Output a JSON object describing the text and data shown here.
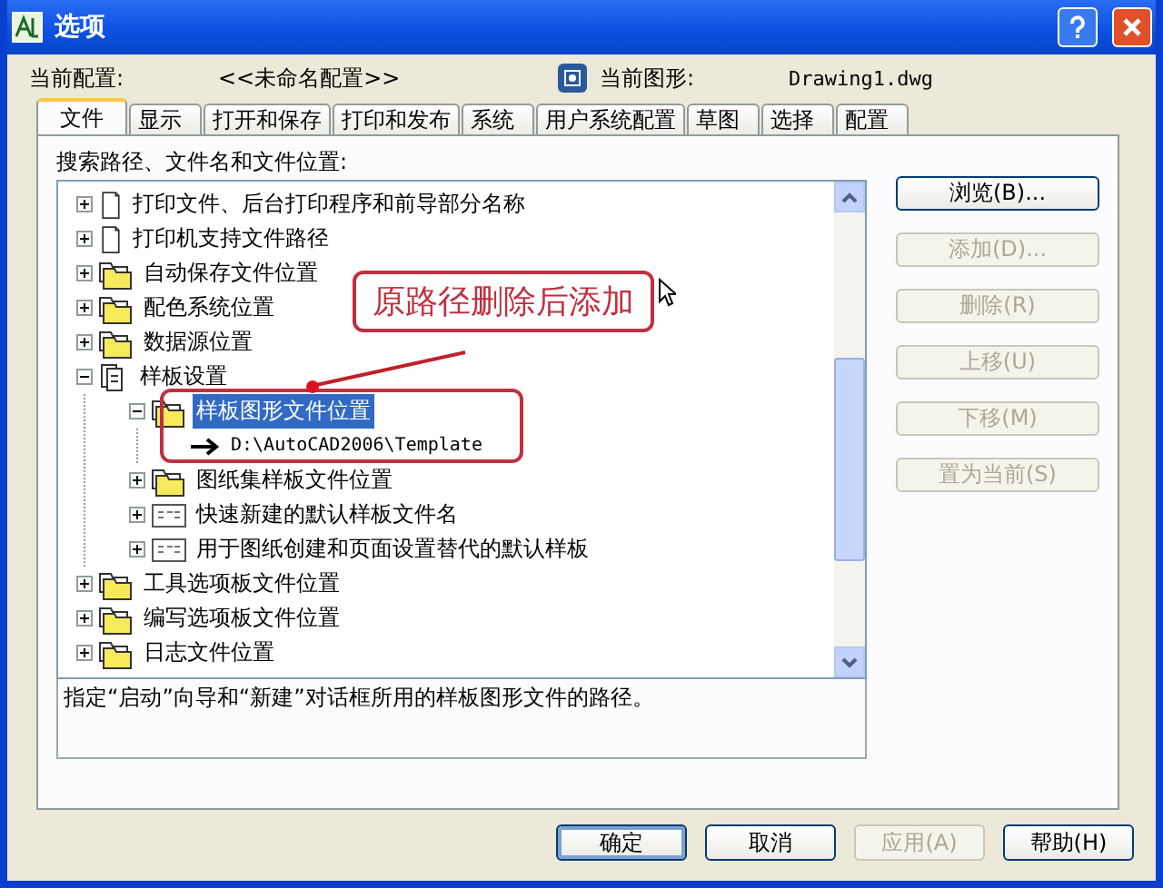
{
  "window": {
    "title": "选项"
  },
  "profile": {
    "label": "当前配置:",
    "value": "<<未命名配置>>"
  },
  "drawing": {
    "label": "当前图形:",
    "value": "Drawing1.dwg"
  },
  "tabs": [
    {
      "label": "文件",
      "selected": true
    },
    {
      "label": "显示",
      "selected": false
    },
    {
      "label": "打开和保存",
      "selected": false
    },
    {
      "label": "打印和发布",
      "selected": false
    },
    {
      "label": "系统",
      "selected": false
    },
    {
      "label": "用户系统配置",
      "selected": false
    },
    {
      "label": "草图",
      "selected": false
    },
    {
      "label": "选择",
      "selected": false
    },
    {
      "label": "配置",
      "selected": false
    }
  ],
  "tree": {
    "label": "搜索路径、文件名和文件位置:",
    "items": [
      {
        "label": "打印文件、后台打印程序和前导部分名称",
        "kind": "doc",
        "expanded": false,
        "selected": false
      },
      {
        "label": "打印机支持文件路径",
        "kind": "doc",
        "expanded": false,
        "selected": false
      },
      {
        "label": "自动保存文件位置",
        "kind": "folder",
        "expanded": false,
        "selected": false
      },
      {
        "label": "配色系统位置",
        "kind": "folder",
        "expanded": false,
        "selected": false
      },
      {
        "label": "数据源位置",
        "kind": "folder",
        "expanded": false,
        "selected": false
      },
      {
        "label": "样板设置",
        "kind": "pages",
        "expanded": true,
        "selected": false,
        "children": [
          {
            "label": "样板图形文件位置",
            "kind": "folder",
            "expanded": true,
            "selected": true,
            "children": [
              {
                "label": "D:\\AutoCAD2006\\Template",
                "kind": "path",
                "selected": false
              }
            ]
          },
          {
            "label": "图纸集样板文件位置",
            "kind": "folder",
            "expanded": false,
            "selected": false
          },
          {
            "label": "快速新建的默认样板文件名",
            "kind": "template",
            "expanded": false,
            "selected": false
          },
          {
            "label": "用于图纸创建和页面设置替代的默认样板",
            "kind": "template",
            "expanded": false,
            "selected": false
          }
        ]
      },
      {
        "label": "工具选项板文件位置",
        "kind": "folder",
        "expanded": false,
        "selected": false
      },
      {
        "label": "编写选项板文件位置",
        "kind": "folder",
        "expanded": false,
        "selected": false
      },
      {
        "label": "日志文件位置",
        "kind": "folder",
        "expanded": false,
        "selected": false
      }
    ]
  },
  "description": "指定“启动”向导和“新建”对话框所用的样板图形文件的路径。",
  "side_buttons": [
    {
      "label": "浏览(B)...",
      "disabled": false
    },
    {
      "label": "添加(D)...",
      "disabled": true
    },
    {
      "label": "删除(R)",
      "disabled": true
    },
    {
      "label": "上移(U)",
      "disabled": true
    },
    {
      "label": "下移(M)",
      "disabled": true
    },
    {
      "label": "置为当前(S)",
      "disabled": true
    }
  ],
  "annotation": {
    "text": "原路径删除后添加"
  },
  "footer_buttons": [
    {
      "label": "确定",
      "disabled": false,
      "default": true
    },
    {
      "label": "取消",
      "disabled": false,
      "default": false
    },
    {
      "label": "应用(A)",
      "disabled": true,
      "default": false
    },
    {
      "label": "帮助(H)",
      "disabled": false,
      "default": false
    }
  ]
}
